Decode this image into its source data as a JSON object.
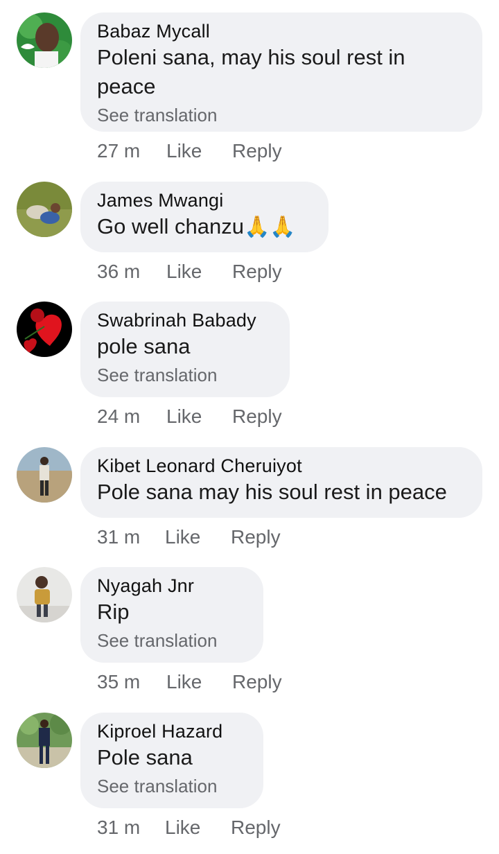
{
  "comments": [
    {
      "author": "Babaz Mycall",
      "text": "Poleni sana, may his soul rest in peace",
      "see_translation": "See translation",
      "time": "27 m",
      "like": "Like",
      "reply": "Reply",
      "avatar_colors": [
        "#2e8b3a",
        "#c7e6b0"
      ]
    },
    {
      "author": "James Mwangi",
      "text": "Go well chanzu",
      "emoji": "🙏🙏",
      "time": "36 m",
      "like": "Like",
      "reply": "Reply",
      "avatar_colors": [
        "#7a8a3a",
        "#d8d2c0"
      ]
    },
    {
      "author": "Swabrinah Babady",
      "text": "pole sana",
      "see_translation": "See translation",
      "time": "24 m",
      "like": "Like",
      "reply": "Reply",
      "avatar_colors": [
        "#000000",
        "#e0141e"
      ]
    },
    {
      "author": "Kibet Leonard Cheruiyot",
      "text": "Pole sana may his soul rest in peace",
      "time": "31 m",
      "like": "Like",
      "reply": "Reply",
      "avatar_colors": [
        "#9fb7c8",
        "#b8a27c"
      ]
    },
    {
      "author": "Nyagah Jnr",
      "text": "Rip",
      "see_translation": "See translation",
      "time": "35 m",
      "like": "Like",
      "reply": "Reply",
      "avatar_colors": [
        "#e8e8e6",
        "#c99b3a"
      ]
    },
    {
      "author": "Kiproel Hazard",
      "text": "Pole sana",
      "see_translation": "See translation",
      "time": "31 m",
      "like": "Like",
      "reply": "Reply",
      "avatar_colors": [
        "#6f9a58",
        "#1f2a48"
      ]
    }
  ]
}
